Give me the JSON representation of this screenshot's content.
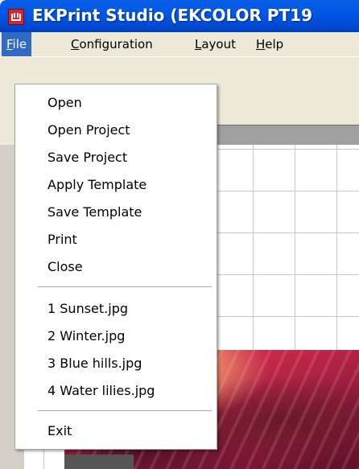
{
  "window": {
    "title": "EKPrint Studio (EKCOLOR PT19"
  },
  "menubar": {
    "items": [
      {
        "mnemonic": "F",
        "rest": "ile"
      },
      {
        "mnemonic": "C",
        "rest": "onfiguration"
      },
      {
        "mnemonic": "L",
        "rest": "ayout"
      },
      {
        "mnemonic": "H",
        "rest": "elp"
      }
    ]
  },
  "file_menu": {
    "items": [
      "Open",
      "Open Project",
      "Save Project",
      "Apply Template",
      "Save Template",
      "Print",
      "Close"
    ],
    "recent": [
      "1 Sunset.jpg",
      "2 Winter.jpg",
      "3 Blue hills.jpg",
      "4 Water lilies.jpg"
    ],
    "exit": "Exit"
  },
  "colors": {
    "titlebar": "#0058E6",
    "menu_highlight": "#316AC5",
    "app_icon": "#D8262C"
  },
  "icons": {
    "app": "ekprint-logo-icon"
  }
}
